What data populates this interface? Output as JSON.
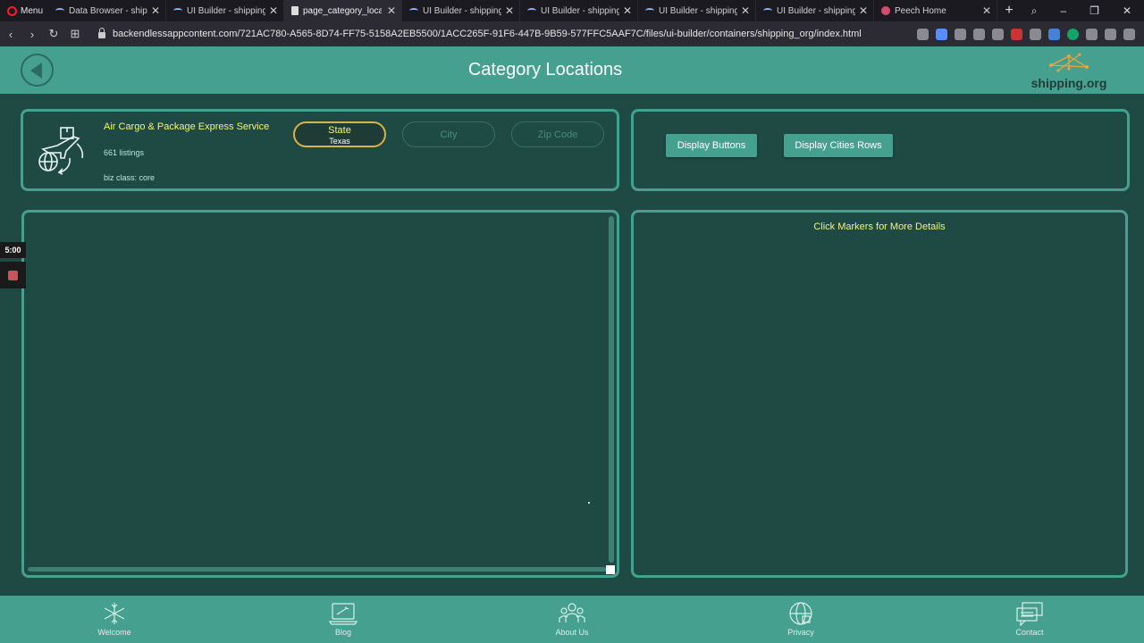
{
  "browser": {
    "menu_label": "Menu",
    "tabs": [
      {
        "label": "Data Browser - shipping",
        "icon": "backendless-icon",
        "active": false
      },
      {
        "label": "UI Builder - shipping_o",
        "icon": "backendless-icon",
        "active": false
      },
      {
        "label": "page_category_location",
        "icon": "page-icon",
        "active": true
      },
      {
        "label": "UI Builder - shipping_o",
        "icon": "backendless-icon",
        "active": false
      },
      {
        "label": "UI Builder - shipping_o",
        "icon": "backendless-icon",
        "active": false
      },
      {
        "label": "UI Builder - shipping_o",
        "icon": "backendless-icon",
        "active": false
      },
      {
        "label": "UI Builder - shipping_o",
        "icon": "backendless-icon",
        "active": false
      },
      {
        "label": "Peech Home",
        "icon": "peech-icon",
        "active": false
      }
    ],
    "url": "backendlessappcontent.com/721AC780-A565-8D74-FF75-5158A2EB5500/1ACC265F-91F6-447B-9B59-577FFC5AAF7C/files/ui-builder/containers/shipping_org/index.html"
  },
  "header": {
    "title": "Category Locations",
    "logo_text": "shipping.org"
  },
  "business": {
    "name": "Air Cargo & Package Express Service",
    "listings": "661 listings",
    "biz_class": "biz class:  core"
  },
  "filters": {
    "state_label": "State",
    "state_value": "Texas",
    "city_label": "City",
    "zip_label": "Zip Code"
  },
  "actions": {
    "display_buttons": "Display Buttons",
    "display_cities_rows": "Display Cities Rows"
  },
  "map": {
    "hint": "Click Markers  for More Details"
  },
  "overlay": {
    "timer": "5:00"
  },
  "footer": {
    "items": [
      {
        "label": "Welcome",
        "icon": "snowflake-icon"
      },
      {
        "label": "Blog",
        "icon": "laptop-icon"
      },
      {
        "label": "About Us",
        "icon": "people-icon"
      },
      {
        "label": "Privacy",
        "icon": "globe-lock-icon"
      },
      {
        "label": "Contact",
        "icon": "chat-icon"
      }
    ]
  },
  "colors": {
    "accent": "#46a08f",
    "background": "#1f4a44",
    "highlight_text": "#f4f37a"
  }
}
